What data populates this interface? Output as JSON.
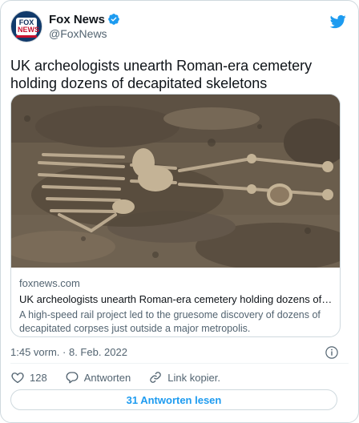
{
  "author": {
    "name": "Fox News",
    "handle": "@FoxNews",
    "avatar_lines": [
      "FOX",
      "NEWS"
    ]
  },
  "tweet": {
    "text": "UK archeologists unearth Roman-era cemetery holding dozens of decapitated skeletons"
  },
  "link_card": {
    "domain": "foxnews.com",
    "title": "UK archeologists unearth Roman-era cemetery holding dozens of decapi…",
    "description": "A high-speed rail project led to the gruesome discovery of dozens of decapitated corpses just outside a major metropolis."
  },
  "meta": {
    "timestamp": "1:45 vorm. · 8. Feb. 2022"
  },
  "actions": {
    "likes": "128",
    "reply_label": "Antworten",
    "copy_link_label": "Link kopier."
  },
  "read_replies_label": "31 Antworten lesen",
  "colors": {
    "accent": "#1d9bf0",
    "text": "#0f1419",
    "secondary": "#536471",
    "border": "#cfd9de"
  },
  "icons": [
    "verified-badge-icon",
    "twitter-bird-icon",
    "info-icon",
    "heart-icon",
    "reply-icon",
    "link-icon"
  ]
}
